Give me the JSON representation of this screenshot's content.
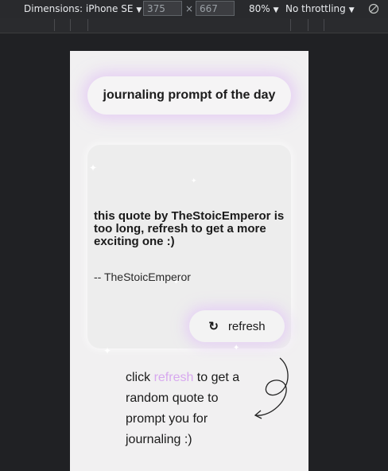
{
  "devtools": {
    "dimensions_label": "Dimensions: iPhone SE",
    "width": "375",
    "times": "×",
    "height": "667",
    "zoom": "80%",
    "throttling": "No throttling",
    "rotate_icon": "rotate-icon"
  },
  "page": {
    "prompt_title": "journaling prompt of the day",
    "quote_text": "this quote by TheStoicEmperor is too long, refresh to get a more exciting one :)",
    "author": "-- TheStoicEmperor",
    "refresh_icon": "↻",
    "refresh_label": "refresh",
    "instruction_before": "click ",
    "instruction_highlight": "refresh",
    "instruction_after": " to get a random quote to prompt you for journaling :)",
    "highlight_color": "#d7a8ef"
  }
}
